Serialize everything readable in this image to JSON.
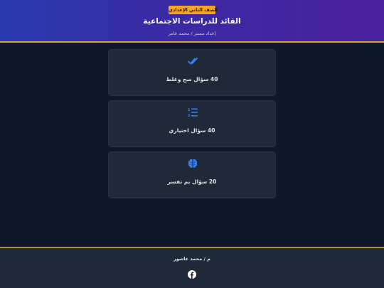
{
  "header": {
    "badge": "الصف الثاني الإعدادي",
    "title": "القائد للدراسات الاجتماعية",
    "subtitle": "إعداد مستر / محمد عامر"
  },
  "cards": [
    {
      "label": "40 سؤال صح وغلط",
      "icon": "double-check-icon"
    },
    {
      "label": "40 سؤال اختياري",
      "icon": "numbered-list-icon"
    },
    {
      "label": "20 سؤال بم تفسر",
      "icon": "brain-icon"
    }
  ],
  "footer": {
    "credit": "م / محمد عاشور",
    "icon": "facebook-icon"
  },
  "colors": {
    "accent": "#3b82f6",
    "badge": "#f5a524",
    "gold_border": "#d4a437",
    "background": "#101827",
    "card": "#1f2937"
  }
}
